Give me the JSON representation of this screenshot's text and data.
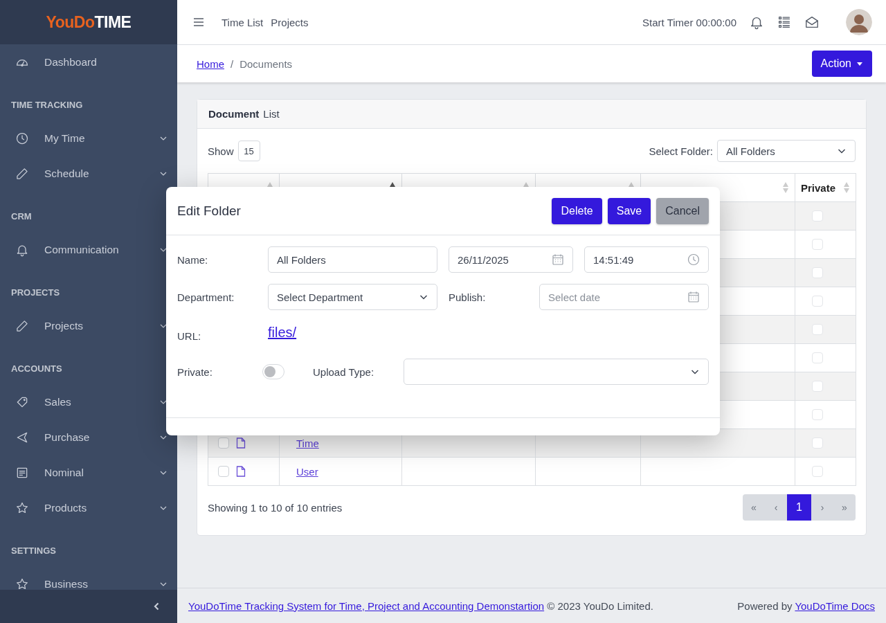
{
  "sidebar": {
    "logo": {
      "brand": "YouDo",
      "product": "TIME"
    },
    "nav": [
      {
        "kind": "link",
        "label": "Dashboard"
      },
      {
        "kind": "heading",
        "label": "TIME TRACKING"
      },
      {
        "kind": "menu",
        "label": "My Time",
        "expanded": false
      },
      {
        "kind": "menu",
        "label": "Schedule",
        "expanded": false
      },
      {
        "kind": "heading",
        "label": "CRM"
      },
      {
        "kind": "menu",
        "label": "Communication",
        "expanded": false
      },
      {
        "kind": "heading",
        "label": "PROJECTS"
      },
      {
        "kind": "menu",
        "label": "Projects",
        "expanded": false
      },
      {
        "kind": "heading",
        "label": "ACCOUNTS"
      },
      {
        "kind": "menu",
        "label": "Sales",
        "expanded": false
      },
      {
        "kind": "menu",
        "label": "Purchase",
        "expanded": false
      },
      {
        "kind": "menu",
        "label": "Nominal",
        "expanded": false
      },
      {
        "kind": "menu",
        "label": "Products",
        "expanded": false
      },
      {
        "kind": "heading",
        "label": "SETTINGS"
      },
      {
        "kind": "menu",
        "label": "Business",
        "expanded": false
      }
    ]
  },
  "topbar": {
    "links": [
      "Time List",
      "Projects"
    ],
    "timer": "Start Timer 00:00:00"
  },
  "breadcrumb": [
    {
      "kind": "link",
      "label": "Home"
    },
    {
      "kind": "separator",
      "label": "/"
    },
    {
      "kind": "current",
      "label": "Documents"
    }
  ],
  "action_button": "Action",
  "card": {
    "title_bold": "Document",
    "title": "List",
    "show_label": "Show",
    "page_size": "15",
    "folder_label": "Select Folder:",
    "folder_value": "All Folders"
  },
  "table": {
    "columns": [
      {
        "sorted_ascending": false
      },
      {
        "sorted_ascending": true
      },
      {
        "sorted_ascending": false
      },
      {
        "sorted_ascending": false
      },
      {
        "sorted_ascending": false
      },
      {
        "label": "Private",
        "sorted_ascending": false
      }
    ],
    "rows": [
      {
        "private": false
      },
      {
        "private": false
      },
      {
        "private": false
      },
      {
        "private": false
      },
      {
        "private": false
      },
      {
        "private": false
      },
      {
        "private": false
      },
      {
        "private": false
      },
      {
        "name": "Time",
        "checked": false,
        "private": false
      },
      {
        "name": "User",
        "checked": false,
        "private": false
      }
    ]
  },
  "info": "Showing 1 to 10 of 10 entries",
  "pagination": {
    "items": [
      {
        "label": "«",
        "selected": false
      },
      {
        "label": "‹",
        "selected": false
      },
      {
        "label": "1",
        "selected": true
      },
      {
        "label": "›",
        "selected": false
      },
      {
        "label": "»",
        "selected": false
      }
    ]
  },
  "footer": {
    "link": "YouDoTime Tracking System for Time, Project and Accounting Demonstartion",
    "copyright": "© 2023 YouDo Limited.",
    "powered": "Powered by",
    "docs_link": "YouDoTime Docs"
  },
  "modal": {
    "title": "Edit Folder",
    "buttons": [
      {
        "kind": "primary",
        "label": "Delete"
      },
      {
        "kind": "primary",
        "label": "Save"
      },
      {
        "kind": "secondary",
        "label": "Cancel"
      }
    ],
    "name_label": "Name:",
    "name_value": "All Folders",
    "date_value": "26/11/2025",
    "time_value": "14:51:49",
    "department_label": "Department:",
    "department_value": "Select Department",
    "publish_label": "Publish:",
    "publish_placeholder": "Select date",
    "url_label": "URL:",
    "url": "files/",
    "private_label": "Private:",
    "private": {
      "on": false
    },
    "upload_label": "Upload Type:"
  }
}
